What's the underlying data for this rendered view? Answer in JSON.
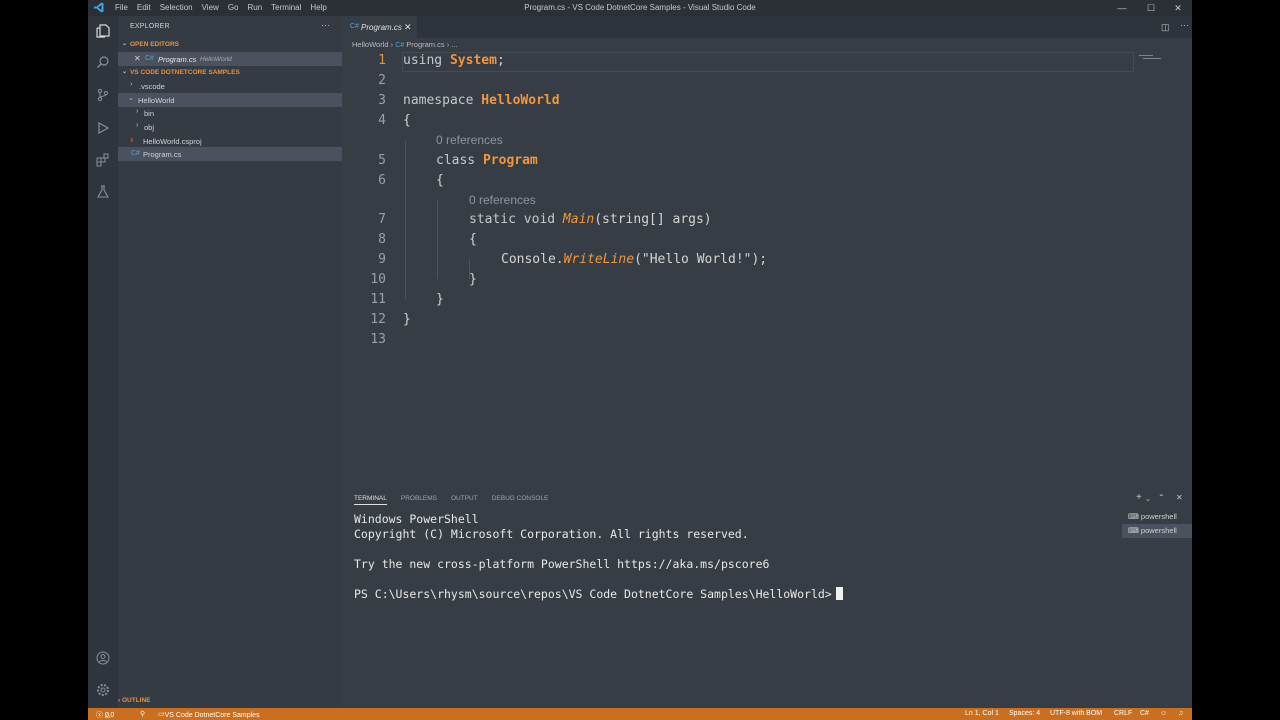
{
  "window": {
    "title": "Program.cs - VS Code DotnetCore Samples - Visual Studio Code"
  },
  "menu": [
    "File",
    "Edit",
    "Selection",
    "View",
    "Go",
    "Run",
    "Terminal",
    "Help"
  ],
  "sidebar": {
    "header": "EXPLORER",
    "open_editors_label": "OPEN EDITORS",
    "open_editor": {
      "name": "Program.cs",
      "folder": "HelloWorld"
    },
    "workspace_label": "VS CODE DOTNETCORE SAMPLES",
    "tree": [
      {
        "label": ".vscode"
      },
      {
        "label": "HelloWorld"
      },
      {
        "label": "bin"
      },
      {
        "label": "obj"
      },
      {
        "label": "HelloWorld.csproj"
      },
      {
        "label": "Program.cs"
      }
    ],
    "outline_label": "OUTLINE"
  },
  "editor": {
    "tab_label": "Program.cs",
    "breadcrumb": [
      "HelloWorld",
      "Program.cs",
      "..."
    ],
    "line_numbers": [
      "1",
      "2",
      "3",
      "4",
      "5",
      "6",
      "7",
      "8",
      "9",
      "10",
      "11",
      "12",
      "13"
    ],
    "code": {
      "l1_kw": "using",
      "l1_ty": "System",
      "l1_end": ";",
      "l3_kw": "namespace",
      "l3_ty": "HelloWorld",
      "l4": "{",
      "lens1": "0 references",
      "l5_kw": "class",
      "l5_ty": "Program",
      "l6": "{",
      "lens2": "0 references",
      "l7_pre": "static void",
      "l7_fn": "Main",
      "l7_post": "(string[] args)",
      "l8": "{",
      "l9_pre": "Console.",
      "l9_fn": "WriteLine",
      "l9_post": "(\"Hello World!\");",
      "l10": "}",
      "l11": "}",
      "l12": "}"
    }
  },
  "panel": {
    "tabs": [
      "TERMINAL",
      "PROBLEMS",
      "OUTPUT",
      "DEBUG CONSOLE"
    ],
    "terminal_lines": [
      "Windows PowerShell",
      "Copyright (C) Microsoft Corporation. All rights reserved.",
      "",
      "Try the new cross-platform PowerShell https://aka.ms/pscore6",
      "",
      "PS C:\\Users\\rhysm\\source\\repos\\VS Code DotnetCore Samples\\HelloWorld>"
    ],
    "terminals": [
      "powershell",
      "powershell"
    ]
  },
  "status": {
    "errors": "0",
    "warnings": "0",
    "folder": "VS Code DotnetCore Samples",
    "position": "Ln 1, Col 1",
    "spaces": "Spaces: 4",
    "encoding": "UTF-8 with BOM",
    "eol": "CRLF",
    "language": "C#"
  },
  "colors": {
    "accent": "#e7913f",
    "statusbar": "#c96f1f",
    "background": "#373d45"
  }
}
